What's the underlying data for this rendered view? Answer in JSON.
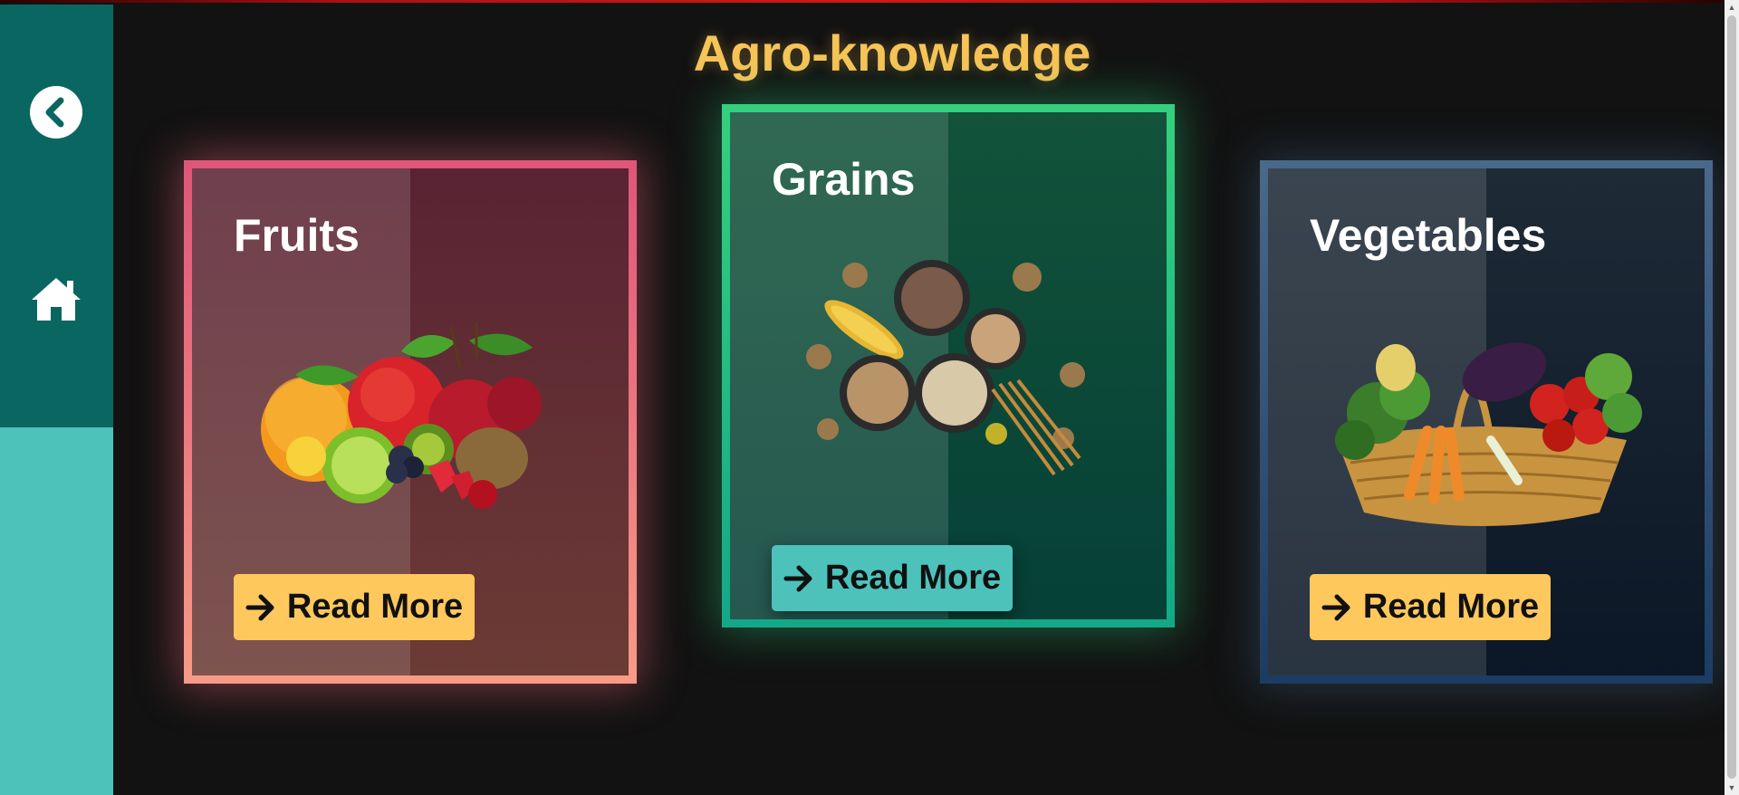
{
  "page": {
    "title": "Agro-knowledge"
  },
  "sidebar": {
    "back_icon": "chevron-left-circle-icon",
    "home_icon": "home-icon"
  },
  "cards": [
    {
      "title": "Fruits",
      "button_label": "Read More",
      "icon": "arrow-right-icon",
      "accent": "#e0567a"
    },
    {
      "title": "Grains",
      "button_label": "Read More",
      "icon": "arrow-right-icon",
      "accent": "#34d07e"
    },
    {
      "title": "Vegetables",
      "button_label": "Read More",
      "icon": "arrow-right-icon",
      "accent": "#48698a"
    }
  ],
  "colors": {
    "sidebar_dark": "#0a6660",
    "sidebar_light": "#4dc2bb",
    "title": "#f6c457",
    "button": "#fec85c"
  }
}
